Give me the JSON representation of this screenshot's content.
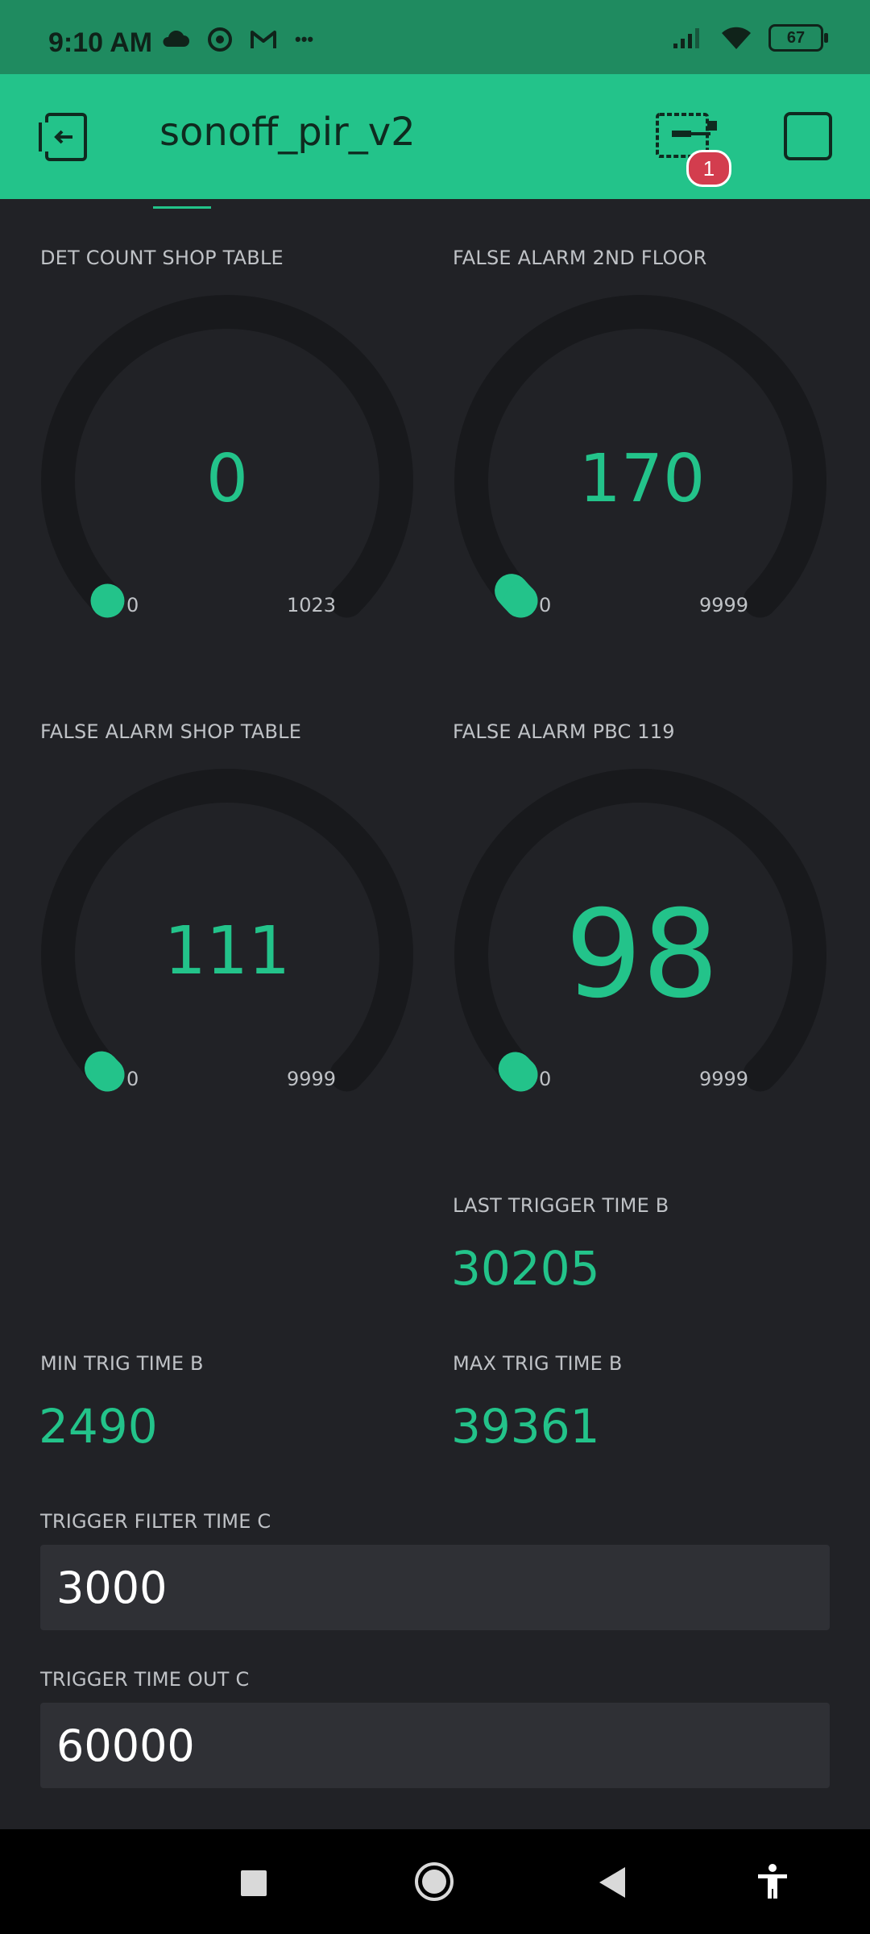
{
  "status_bar": {
    "time": "9:10 AM",
    "more": "•••",
    "battery": "67"
  },
  "header": {
    "title": "sonoff_pir_v2",
    "device_badge": "1"
  },
  "gauges": [
    {
      "label": "DET COUNT SHOP TABLE",
      "value": "0",
      "min": "0",
      "max": "1023",
      "fraction": 0.0
    },
    {
      "label": "FALSE ALARM 2ND FLOOR",
      "value": "170",
      "min": "0",
      "max": "9999",
      "fraction": 0.017
    },
    {
      "label": "FALSE ALARM SHOP TABLE",
      "value": "111",
      "min": "0",
      "max": "9999",
      "fraction": 0.011
    },
    {
      "label": "FALSE ALARM PBC 119",
      "value": "98",
      "min": "0",
      "max": "9999",
      "fraction": 0.0098
    }
  ],
  "displays": {
    "last_trigger": {
      "label": "LAST TRIGGER TIME B",
      "value": "30205"
    },
    "min_trig": {
      "label": "MIN TRIG TIME B",
      "value": "2490"
    },
    "max_trig": {
      "label": "MAX TRIG TIME B",
      "value": "39361"
    }
  },
  "inputs": {
    "filter": {
      "label": "TRIGGER FILTER TIME C",
      "value": "3000"
    },
    "timeout": {
      "label": "TRIGGER TIME OUT C",
      "value": "60000"
    }
  },
  "colors": {
    "accent": "#23c38a",
    "header": "#23c38a",
    "status_bar": "#1f8b60",
    "background": "#212226",
    "gauge_track": "#18191c",
    "badge": "#d33d4e"
  },
  "icons": {
    "back": "exit-arrow-icon",
    "device": "device-board-icon",
    "menu": "square-icon"
  }
}
